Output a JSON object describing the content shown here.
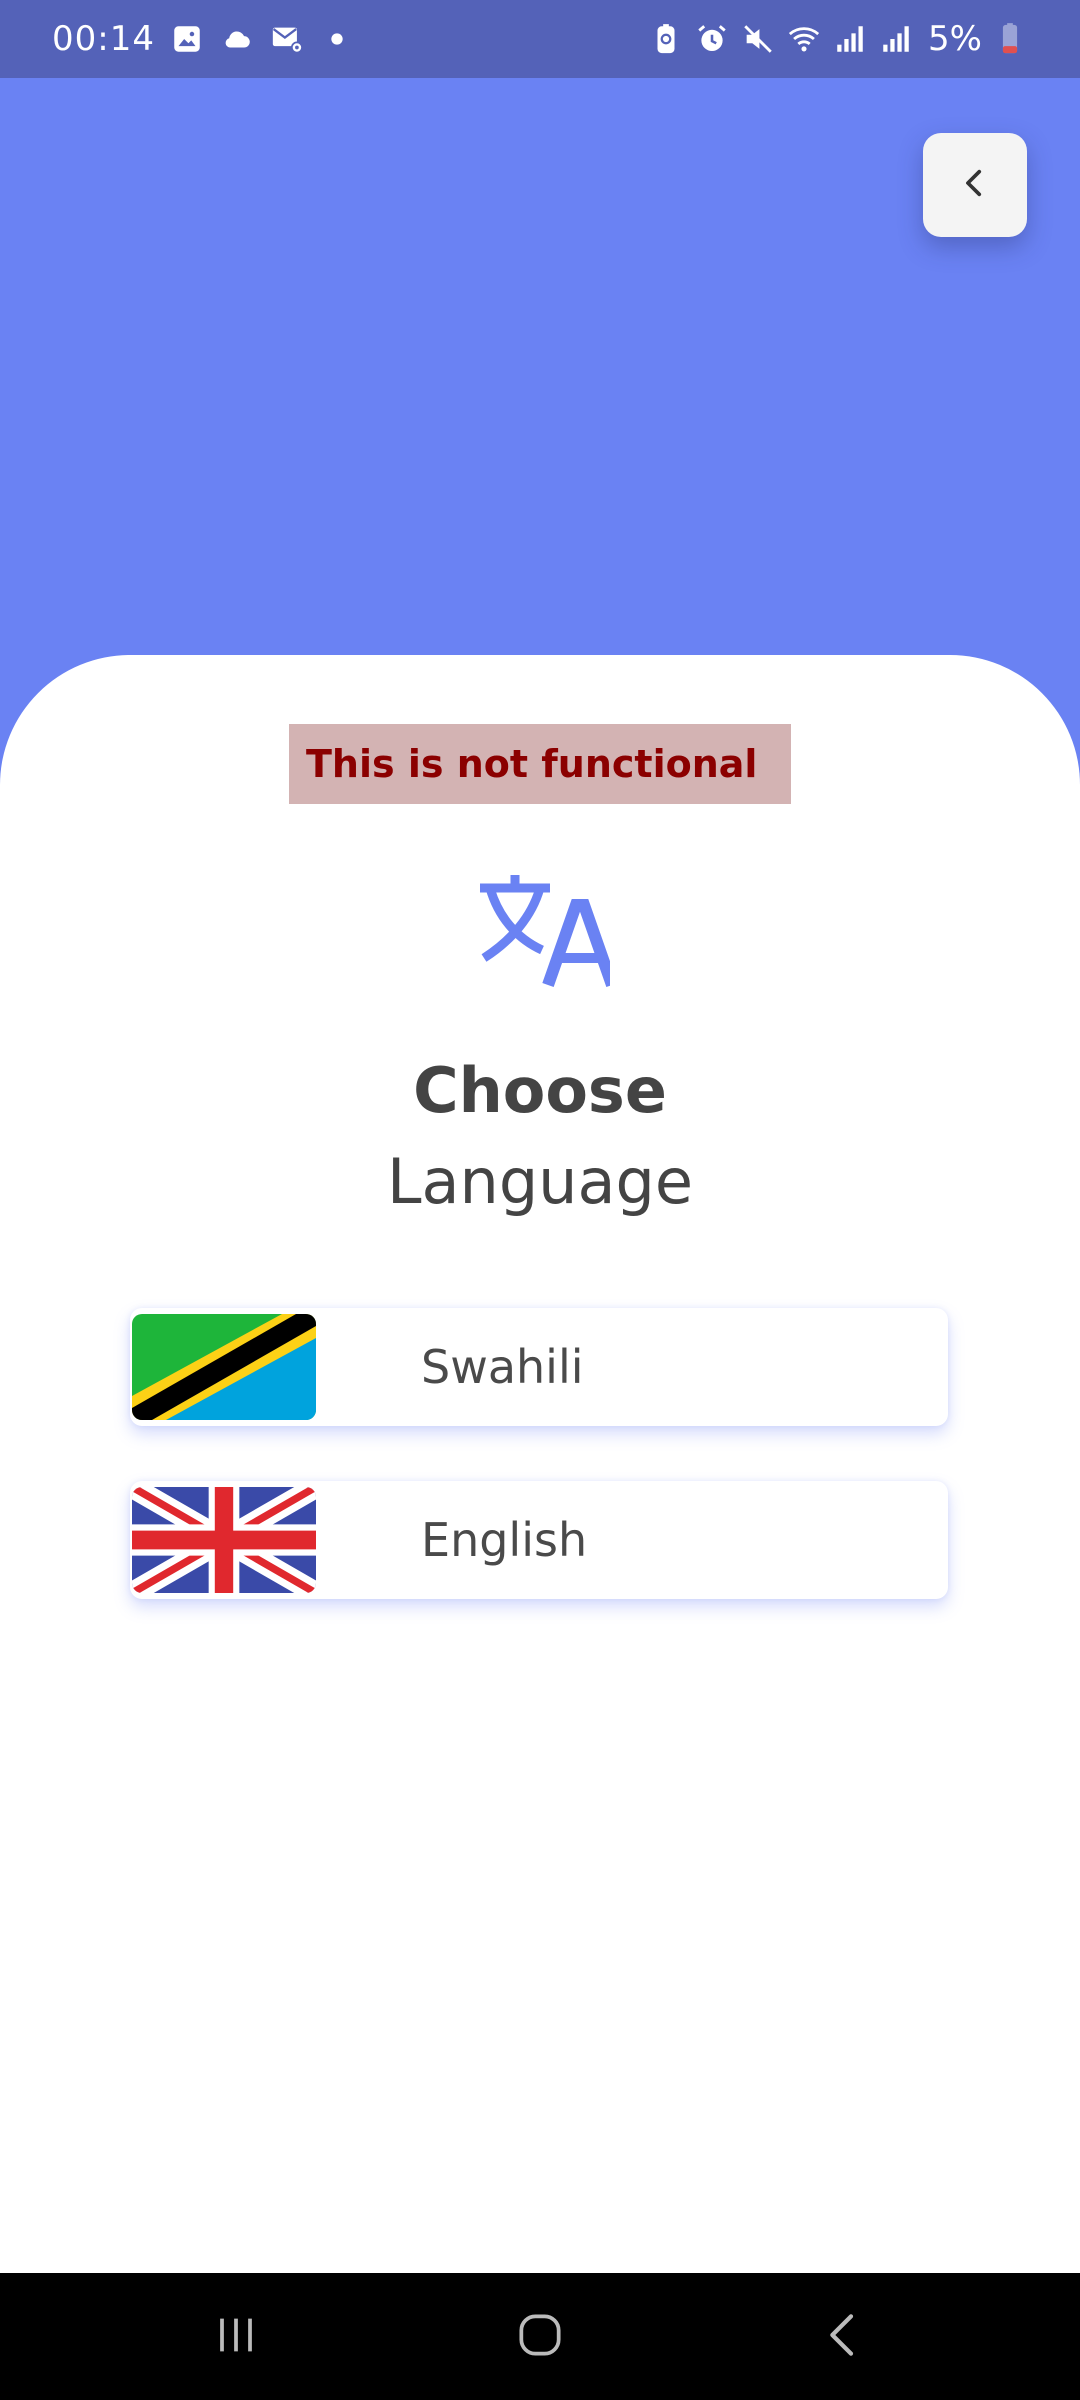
{
  "status_bar": {
    "time": "00:14",
    "battery_percent": "5%",
    "left_icons": [
      "gallery-icon",
      "cloud-icon",
      "mail-settings-icon",
      "notification-dot-icon"
    ],
    "right_icons": [
      "battery-saver-icon",
      "alarm-icon",
      "mute-icon",
      "wifi-icon",
      "signal-icon",
      "signal-icon",
      "battery-low-icon"
    ]
  },
  "header": {
    "background_color": "#6a82f3",
    "back_icon": "chevron-left-icon"
  },
  "notice": {
    "text": "This is not functional",
    "text_color": "#8b0000",
    "background_color": "#d3b3b3"
  },
  "page": {
    "icon": "translate-icon",
    "title_primary": "Choose",
    "title_secondary": "Language"
  },
  "languages": [
    {
      "label": "Swahili",
      "flag": "tanzania-flag-icon"
    },
    {
      "label": "English",
      "flag": "uk-flag-icon"
    }
  ],
  "nav_bar": {
    "icons": [
      "recents-icon",
      "home-icon",
      "back-icon"
    ]
  }
}
